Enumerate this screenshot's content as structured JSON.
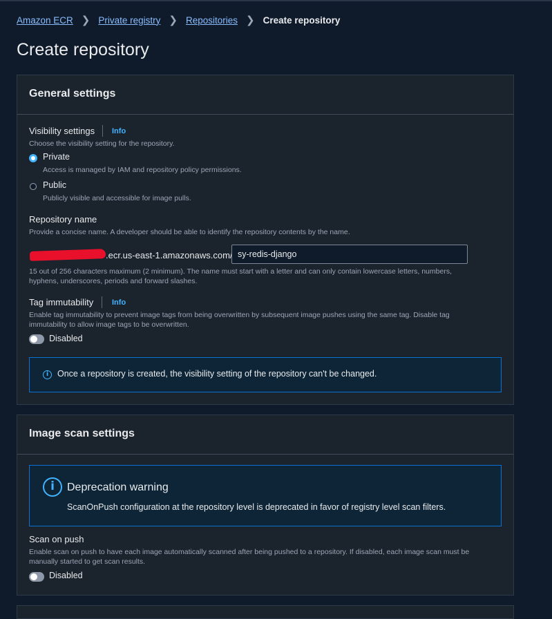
{
  "breadcrumb": {
    "items": [
      "Amazon ECR",
      "Private registry",
      "Repositories"
    ],
    "current": "Create repository"
  },
  "page_title": "Create repository",
  "general_settings": {
    "title": "General settings",
    "visibility": {
      "label": "Visibility settings",
      "info": "Info",
      "description": "Choose the visibility setting for the repository.",
      "options": [
        {
          "label": "Private",
          "description": "Access is managed by IAM and repository policy permissions.",
          "selected": true
        },
        {
          "label": "Public",
          "description": "Publicly visible and accessible for image pulls.",
          "selected": false
        }
      ]
    },
    "repository_name": {
      "label": "Repository name",
      "description": "Provide a concise name. A developer should be able to identify the repository contents by the name.",
      "prefix": ".ecr.us-east-1.amazonaws.com/",
      "value": "sy-redis-django",
      "constraint_line1": "15 out of 256 characters maximum (2 minimum). The name must start with a letter and can only contain lowercase letters, numbers,",
      "constraint_line2": "hyphens, underscores, periods and forward slashes."
    },
    "tag_immutability": {
      "label": "Tag immutability",
      "info": "Info",
      "description_line1": "Enable tag immutability to prevent image tags from being overwritten by subsequent image pushes using the same tag. Disable tag",
      "description_line2": "immutability to allow image tags to be overwritten.",
      "toggle_label": "Disabled",
      "enabled": false
    },
    "alert": "Once a repository is created, the visibility setting of the repository can't be changed."
  },
  "image_scan_settings": {
    "title": "Image scan settings",
    "warning": {
      "title": "Deprecation warning",
      "text": "ScanOnPush configuration at the repository level is deprecated in favor of registry level scan filters."
    },
    "scan_on_push": {
      "label": "Scan on push",
      "description_line1": "Enable scan on push to have each image automatically scanned after being pushed to a repository. If disabled, each image scan must be",
      "description_line2": "manually started to get scan results.",
      "toggle_label": "Disabled",
      "enabled": false
    }
  },
  "colors": {
    "background": "#0f1b2a",
    "panel": "#1b232d",
    "link": "#89bdff",
    "accent": "#42b4ff",
    "alert_border": "#0972d3",
    "redaction": "#e8102a"
  }
}
